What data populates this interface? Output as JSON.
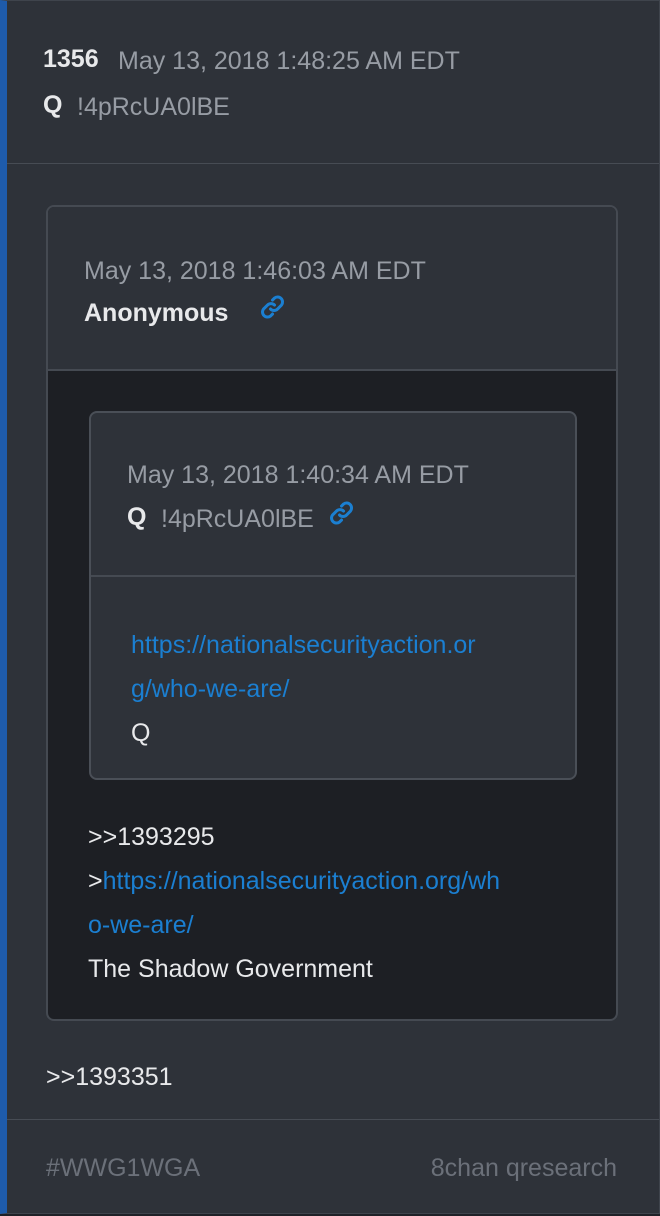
{
  "post": {
    "number": "1356",
    "date": "May 13, 2018 1:48:25 AM EDT",
    "author": "Q",
    "tripcode": "!4pRcUA0lBE",
    "body_reply_ref": ">>1393351"
  },
  "quoted_post": {
    "date": "May 13, 2018 1:46:03 AM EDT",
    "author": "Anonymous",
    "link_icon": "link-icon",
    "reply_ref": ">>1393295",
    "greentext_prefix": ">",
    "link_line1": "https://nationalsecurityaction.org/wh",
    "link_line2": "o-we-are/",
    "closing_text": "The Shadow Government"
  },
  "nested_quote": {
    "date": "May 13, 2018 1:40:34 AM EDT",
    "author": "Q",
    "tripcode": "!4pRcUA0lBE",
    "link_icon": "link-icon",
    "link_line1": "https://nationalsecurityaction.or",
    "link_line2": "g/who-we-are/",
    "signature": "Q"
  },
  "footer": {
    "hashtag": "#WWG1WGA",
    "source": "8chan qresearch"
  },
  "colors": {
    "accent_bar": "#1e5bab",
    "link": "#1b7fd1",
    "background": "#2e3239"
  }
}
